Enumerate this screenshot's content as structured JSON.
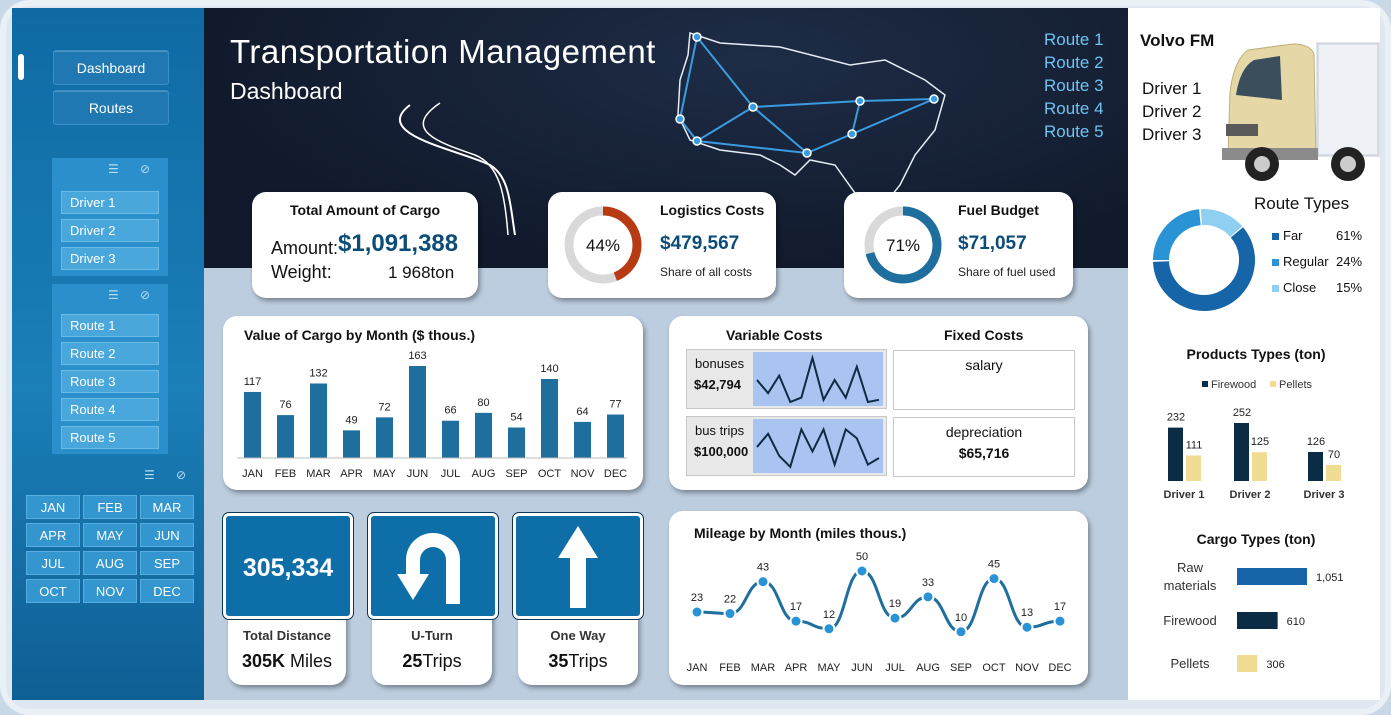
{
  "nav": {
    "dashboard": "Dashboard",
    "routes": "Routes"
  },
  "drivers": [
    "Driver 1",
    "Driver 2",
    "Driver 3"
  ],
  "routes": [
    "Route 1",
    "Route 2",
    "Route 3",
    "Route 4",
    "Route 5"
  ],
  "months": [
    "JAN",
    "FEB",
    "MAR",
    "APR",
    "MAY",
    "JUN",
    "JUL",
    "AUG",
    "SEP",
    "OCT",
    "NOV",
    "DEC"
  ],
  "header": {
    "title": "Transportation Management",
    "subtitle": "Dashboard"
  },
  "cargo_card": {
    "title": "Total Amount of Cargo",
    "amount_label": "Amount:",
    "amount": "$1,091,388",
    "weight_label": "Weight:",
    "weight": "1 968ton"
  },
  "logistics": {
    "title": "Logistics Costs",
    "percent": "44%",
    "pct": 44,
    "value": "$479,567",
    "caption": "Share of all costs",
    "color": "#b73a12"
  },
  "fuel": {
    "title": "Fuel Budget",
    "percent": "71%",
    "pct": 71,
    "value": "$71,057",
    "caption": "Share of fuel used",
    "color": "#1f6f9e"
  },
  "variable": {
    "title": "Variable Costs",
    "fixed_title": "Fixed Costs",
    "bonuses_label": "bonuses",
    "bonuses": "$42,794",
    "bus_label": "bus trips",
    "bus": "$100,000",
    "salary": "salary",
    "depreciation_label": "depreciation",
    "depreciation": "$65,716"
  },
  "signs": {
    "distance_value": "305,334",
    "distance_label": "Total Distance",
    "distance_big": "305K",
    "distance_unit": " Miles",
    "uturn_label": "U-Turn",
    "uturn_big": "25",
    "uturn_unit": "Trips",
    "oneway_label": "One Way",
    "oneway_big": "35",
    "oneway_unit": "Trips"
  },
  "truck": {
    "title": "Volvo FM"
  },
  "route_types": {
    "title": "Route Types",
    "items": [
      {
        "name": "Far",
        "pct": "61%",
        "v": 61,
        "color": "#1565a8"
      },
      {
        "name": "Regular",
        "pct": "24%",
        "v": 24,
        "color": "#2a93d5"
      },
      {
        "name": "Close",
        "pct": "15%",
        "v": 15,
        "color": "#8fd0f2"
      }
    ]
  },
  "colors": {
    "navy": "#0b2c45",
    "tan": "#f1dc93",
    "bar": "#1f6f9e",
    "lineBg": "#a9c4f0"
  },
  "chart_data": [
    {
      "type": "bar",
      "title": "Value of Cargo by Month ($ thous.)",
      "categories": [
        "JAN",
        "FEB",
        "MAR",
        "APR",
        "MAY",
        "JUN",
        "JUL",
        "AUG",
        "SEP",
        "OCT",
        "NOV",
        "DEC"
      ],
      "values": [
        117,
        76,
        132,
        49,
        72,
        163,
        66,
        80,
        54,
        140,
        64,
        77
      ]
    },
    {
      "type": "line",
      "title": "Mileage by Month  (miles thous.)",
      "categories": [
        "JAN",
        "FEB",
        "MAR",
        "APR",
        "MAY",
        "JUN",
        "JUL",
        "AUG",
        "SEP",
        "OCT",
        "NOV",
        "DEC"
      ],
      "values": [
        23,
        22,
        43,
        17,
        12,
        50,
        19,
        33,
        10,
        45,
        13,
        17
      ]
    },
    {
      "type": "bar",
      "title": "Products Types (ton)",
      "categories": [
        "Driver 1",
        "Driver 2",
        "Driver 3"
      ],
      "series": [
        {
          "name": "Firewood",
          "values": [
            232,
            252,
            126
          ]
        },
        {
          "name": "Pellets",
          "values": [
            111,
            125,
            70
          ]
        }
      ]
    },
    {
      "type": "bar",
      "title": "Cargo Types (ton)",
      "categories": [
        "Raw materials",
        "Firewood",
        "Pellets"
      ],
      "values": [
        1051,
        610,
        306
      ],
      "value_labels": [
        "1,051",
        "610",
        "306"
      ]
    }
  ]
}
